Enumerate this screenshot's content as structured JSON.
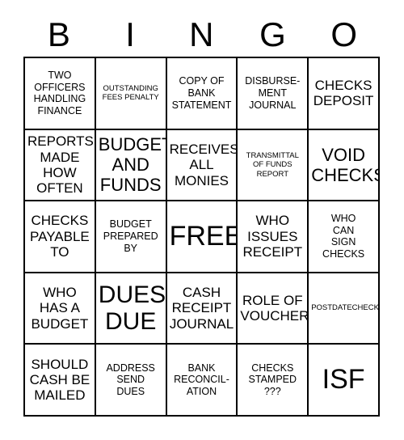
{
  "header": {
    "letters": [
      "B",
      "I",
      "N",
      "G",
      "O"
    ]
  },
  "grid": {
    "rows": 5,
    "columns": 5,
    "border_color": "#000000",
    "background_color": "#ffffff",
    "text_color": "#000000",
    "cells": [
      {
        "text": "TWO\nOFFICERS\nHANDLING\nFINANCE",
        "size": "sm",
        "free": false
      },
      {
        "text": "OUTSTANDING\nFEES PENALTY",
        "size": "xs",
        "free": false
      },
      {
        "text": "COPY OF\nBANK\nSTATEMENT",
        "size": "sm",
        "free": false
      },
      {
        "text": "DISBURSE-\nMENT\nJOURNAL",
        "size": "sm",
        "free": false
      },
      {
        "text": "CHECKS\nDEPOSIT",
        "size": "md",
        "free": false
      },
      {
        "text": "REPORTS\nMADE\nHOW\nOFTEN",
        "size": "md",
        "free": false
      },
      {
        "text": "BUDGET\nAND\nFUNDS",
        "size": "lg",
        "free": false
      },
      {
        "text": "RECEIVES\nALL\nMONIES",
        "size": "md",
        "free": false
      },
      {
        "text": "TRANSMITTAL\nOF FUNDS\nREPORT",
        "size": "xs",
        "free": false
      },
      {
        "text": "VOID\nCHECKS",
        "size": "lg",
        "free": false
      },
      {
        "text": "CHECKS\nPAYABLE\nTO",
        "size": "md",
        "free": false
      },
      {
        "text": "BUDGET\nPREPARED\nBY",
        "size": "sm",
        "free": false
      },
      {
        "text": "FREE",
        "size": "xxl",
        "free": true
      },
      {
        "text": "WHO\nISSUES\nRECEIPT",
        "size": "md",
        "free": false
      },
      {
        "text": "WHO\nCAN\nSIGN\nCHECKS",
        "size": "sm",
        "free": false
      },
      {
        "text": "WHO\nHAS A\nBUDGET",
        "size": "md",
        "free": false
      },
      {
        "text": "DUES\nDUE",
        "size": "xl",
        "free": false
      },
      {
        "text": "CASH\nRECEIPT\nJOURNAL",
        "size": "md",
        "free": false
      },
      {
        "text": "ROLE OF\nVOUCHER",
        "size": "md",
        "free": false
      },
      {
        "text": "POSTDATECHECKS",
        "size": "xs",
        "free": false
      },
      {
        "text": "SHOULD\nCASH BE\nMAILED",
        "size": "md",
        "free": false
      },
      {
        "text": "ADDRESS\nSEND\nDUES",
        "size": "sm",
        "free": false
      },
      {
        "text": "BANK\nRECONCIL-\nATION",
        "size": "sm",
        "free": false
      },
      {
        "text": "CHECKS\nSTAMPED\n???",
        "size": "sm",
        "free": false
      },
      {
        "text": "ISF",
        "size": "xxl",
        "free": false
      }
    ]
  }
}
